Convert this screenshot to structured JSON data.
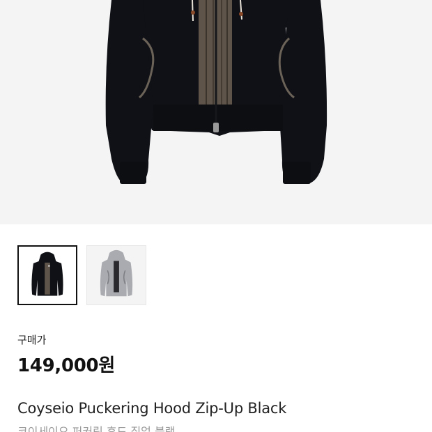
{
  "hero_image": {
    "icon": "hoodie-black-image",
    "background_color": "#f4f4f4",
    "garment_color": "#0f1116",
    "trim_color": "#6b6258"
  },
  "thumbnails": [
    {
      "icon": "hoodie-black-thumbnail",
      "selected": true
    },
    {
      "icon": "hoodie-gray-thumbnail",
      "selected": false
    }
  ],
  "purchase": {
    "label": "구매가",
    "price": "149,000원"
  },
  "product": {
    "name": "Coyseio Puckering Hood Zip-Up Black",
    "name_kr": "코이세이오 퍼커링 후드 집업 블랙"
  }
}
